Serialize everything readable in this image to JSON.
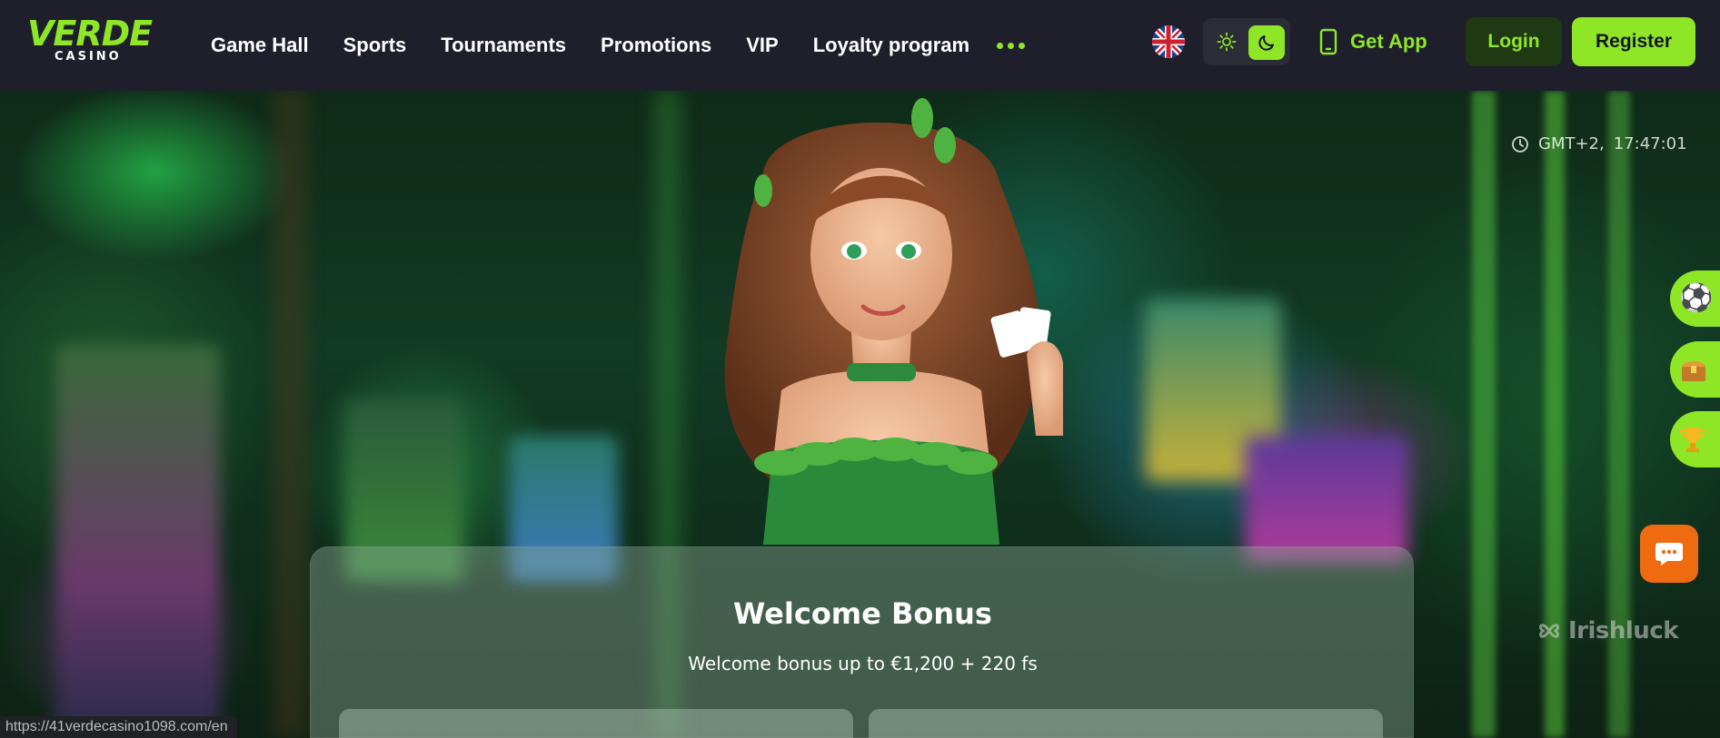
{
  "brand": {
    "name": "VERDE",
    "sub": "CASINO"
  },
  "nav": {
    "items": [
      "Game Hall",
      "Sports",
      "Tournaments",
      "Promotions",
      "VIP",
      "Loyalty program"
    ]
  },
  "header": {
    "language_icon": "uk-flag-icon",
    "get_app_label": "Get App",
    "login_label": "Login",
    "register_label": "Register"
  },
  "hero": {
    "timezone": "GMT+2,",
    "time": "17:47:01",
    "side_buttons": [
      "soccer-ball-icon",
      "treasure-chest-icon",
      "trophy-icon"
    ],
    "watermark": "Irishluck"
  },
  "bonus": {
    "title": "Welcome Bonus",
    "subtitle": "Welcome bonus up to €1,200 + 220 fs"
  },
  "status_bar": {
    "url": "https://41verdecasino1098.com/en"
  },
  "colors": {
    "accent": "#8ee626",
    "header_bg": "#1e1f2b",
    "chat": "#f06a10"
  }
}
